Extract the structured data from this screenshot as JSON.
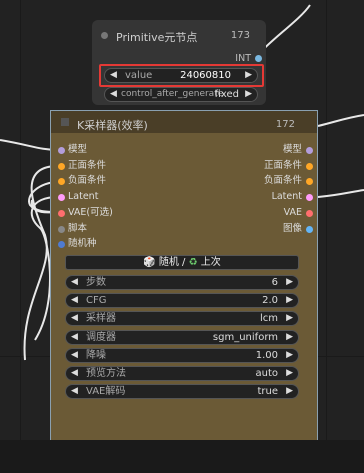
{
  "primitive_node": {
    "title": "Primitive元节点",
    "id": "173",
    "output_type": "INT",
    "widgets": [
      {
        "label": "value",
        "value": "24060810"
      },
      {
        "label": "control_after_generate",
        "value": "fixed"
      }
    ]
  },
  "ksampler_node": {
    "title": "K采样器(效率)",
    "id": "172",
    "inputs": [
      {
        "label": "模型",
        "color": "#b39ddb"
      },
      {
        "label": "正面条件",
        "color": "#ffa726"
      },
      {
        "label": "负面条件",
        "color": "#ffa726"
      },
      {
        "label": "Latent",
        "color": "#ff9cf9"
      },
      {
        "label": "VAE(可选)",
        "color": "#ff6e6e"
      },
      {
        "label": "脚本",
        "color": "#888888"
      },
      {
        "label": "随机种",
        "color": "#4f7bd1"
      }
    ],
    "outputs": [
      {
        "label": "模型",
        "color": "#b39ddb"
      },
      {
        "label": "正面条件",
        "color": "#ffa726"
      },
      {
        "label": "负面条件",
        "color": "#ffa726"
      },
      {
        "label": "Latent",
        "color": "#ff9cf9"
      },
      {
        "label": "VAE",
        "color": "#ff6e6e"
      },
      {
        "label": "图像",
        "color": "#64b5f6"
      }
    ],
    "seed_button": {
      "dice": "🎲",
      "random": "随机",
      "sep": "/",
      "recycle": "♻",
      "last": "上次"
    },
    "widgets": [
      {
        "label": "步数",
        "value": "6"
      },
      {
        "label": "CFG",
        "value": "2.0"
      },
      {
        "label": "采样器",
        "value": "lcm"
      },
      {
        "label": "调度器",
        "value": "sgm_uniform"
      },
      {
        "label": "降噪",
        "value": "1.00"
      },
      {
        "label": "预览方法",
        "value": "auto"
      },
      {
        "label": "VAE解码",
        "value": "true"
      }
    ]
  },
  "colors": {
    "node_body": "#353535",
    "ksampler_body": "#6b5a36",
    "highlight": "#e53935"
  }
}
